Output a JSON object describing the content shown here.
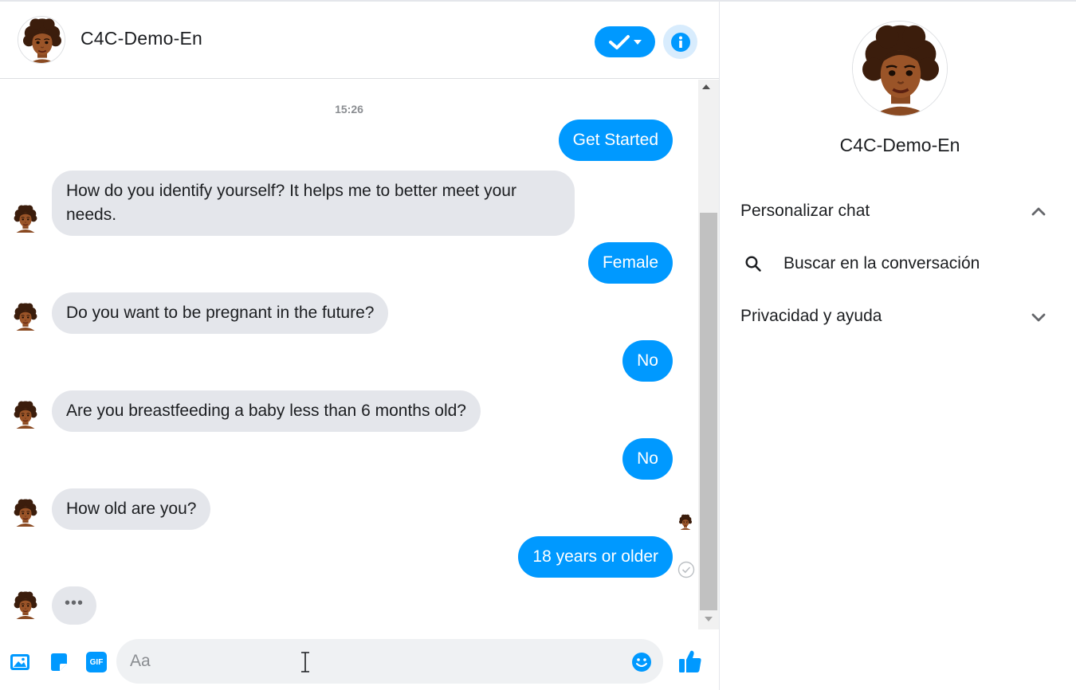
{
  "chat": {
    "header": {
      "name": "C4C-Demo-En"
    },
    "timestamp": "15:26",
    "messages": [
      {
        "from": "user",
        "text": "Get Started"
      },
      {
        "from": "bot",
        "lines": [
          "How do you identify yourself? It helps me to better meet your",
          "needs."
        ]
      },
      {
        "from": "user",
        "text": "Female"
      },
      {
        "from": "bot",
        "text": "Do you want to be pregnant in the future?"
      },
      {
        "from": "user",
        "text": "No"
      },
      {
        "from": "bot",
        "text": "Are you breastfeeding a baby less than 6 months old?"
      },
      {
        "from": "user",
        "text": "No"
      },
      {
        "from": "bot",
        "text": "How old are you?"
      },
      {
        "from": "user",
        "text": "18 years or older"
      }
    ],
    "typing_indicator": "•••",
    "composer": {
      "placeholder": "Aa",
      "icons": [
        "photo-icon",
        "sticker-icon",
        "gif-icon",
        "emoji-icon",
        "thumbs-up-icon"
      ],
      "gif_label": "GIF"
    }
  },
  "info_panel": {
    "name": "C4C-Demo-En",
    "sections": {
      "customize": "Personalizar chat",
      "search": "Buscar en la conversación",
      "privacy": "Privacidad y ayuda"
    }
  },
  "colors": {
    "accent": "#0099ff",
    "incoming_bubble": "#e4e6eb",
    "info_button_bg": "#d8ecfd"
  }
}
